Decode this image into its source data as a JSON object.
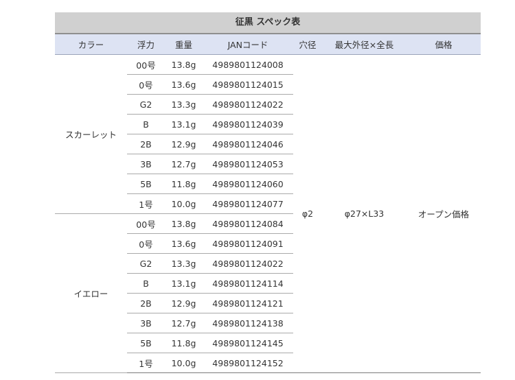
{
  "table": {
    "title": "征黒 スペック表",
    "headers": [
      "カラー",
      "浮力",
      "重量",
      "JANコード",
      "穴径",
      "最大外径×全長",
      "価格"
    ],
    "shared": {
      "hole": "φ2",
      "size": "φ27×L33",
      "price": "オープン価格"
    },
    "groups": [
      {
        "color": "スカーレット",
        "rows": [
          {
            "buoyancy": "00号",
            "weight": "13.8g",
            "jan": "4989801124008"
          },
          {
            "buoyancy": "0号",
            "weight": "13.6g",
            "jan": "4989801124015"
          },
          {
            "buoyancy": "G2",
            "weight": "13.3g",
            "jan": "4989801124022"
          },
          {
            "buoyancy": "B",
            "weight": "13.1g",
            "jan": "4989801124039"
          },
          {
            "buoyancy": "2B",
            "weight": "12.9g",
            "jan": "4989801124046"
          },
          {
            "buoyancy": "3B",
            "weight": "12.7g",
            "jan": "4989801124053"
          },
          {
            "buoyancy": "5B",
            "weight": "11.8g",
            "jan": "4989801124060"
          },
          {
            "buoyancy": "1号",
            "weight": "10.0g",
            "jan": "4989801124077"
          }
        ]
      },
      {
        "color": "イエロー",
        "rows": [
          {
            "buoyancy": "00号",
            "weight": "13.8g",
            "jan": "4989801124084"
          },
          {
            "buoyancy": "0号",
            "weight": "13.6g",
            "jan": "4989801124091"
          },
          {
            "buoyancy": "G2",
            "weight": "13.3g",
            "jan": "4989801124022"
          },
          {
            "buoyancy": "B",
            "weight": "13.1g",
            "jan": "4989801124114"
          },
          {
            "buoyancy": "2B",
            "weight": "12.9g",
            "jan": "4989801124121"
          },
          {
            "buoyancy": "3B",
            "weight": "12.7g",
            "jan": "4989801124138"
          },
          {
            "buoyancy": "5B",
            "weight": "11.8g",
            "jan": "4989801124145"
          },
          {
            "buoyancy": "1号",
            "weight": "10.0g",
            "jan": "4989801124152"
          }
        ]
      }
    ]
  }
}
